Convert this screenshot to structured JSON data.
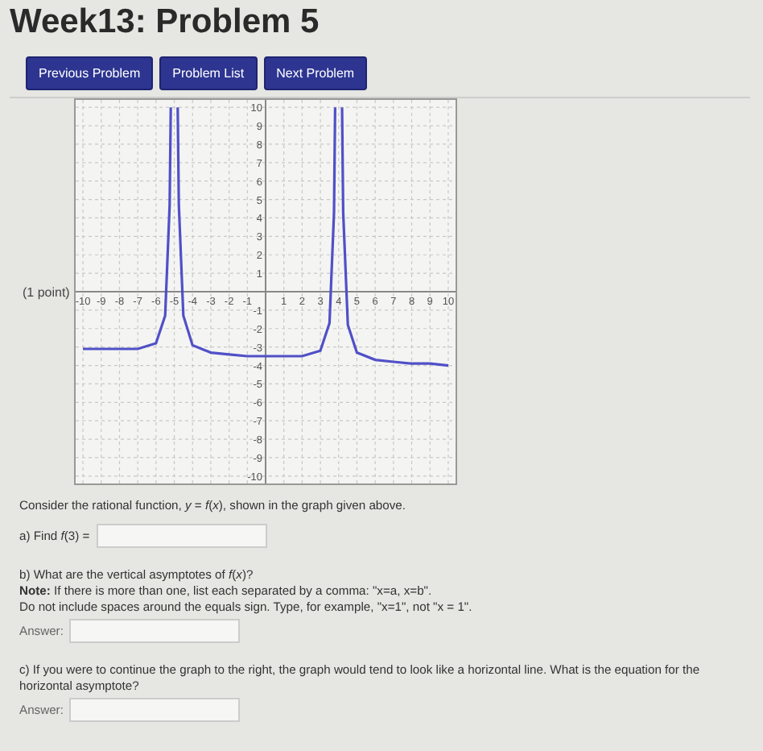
{
  "title": "Week13: Problem 5",
  "nav_buttons": [
    "Previous Problem",
    "Problem List",
    "Next Problem"
  ],
  "points": "(1 point)",
  "graph": {
    "chart_data": {
      "type": "line",
      "xlim": [
        -10,
        10
      ],
      "ylim": [
        -10,
        10
      ],
      "xticks": [
        -10,
        -9,
        -8,
        -7,
        -6,
        -5,
        -4,
        -3,
        -2,
        -1,
        1,
        2,
        3,
        4,
        5,
        6,
        7,
        8,
        9,
        10
      ],
      "yticks": [
        -10,
        -9,
        -8,
        -7,
        -6,
        -5,
        -4,
        -3,
        -2,
        -1,
        1,
        2,
        3,
        4,
        5,
        6,
        7,
        8,
        9,
        10
      ],
      "grid": true,
      "x": [
        -10,
        -9,
        -8,
        -7,
        -6,
        -5.5,
        -5.25,
        -5.19,
        -5,
        -4.81,
        -4.75,
        -4.5,
        -4,
        -3,
        -2,
        -1,
        0,
        1,
        2,
        3,
        3.5,
        3.75,
        3.81,
        4,
        4.19,
        4.25,
        4.5,
        5,
        6,
        7,
        8,
        9,
        10
      ],
      "series": [
        {
          "color": "#5050c8",
          "values": [
            -3.1,
            -3.1,
            -3.1,
            -3.1,
            -2.8,
            -1.3,
            4.7,
            10,
            null,
            10,
            4.7,
            -1.3,
            -2.9,
            -3.3,
            -3.4,
            -3.5,
            -3.5,
            -3.5,
            -3.5,
            -3.2,
            -1.7,
            4.3,
            10,
            null,
            10,
            4.3,
            -1.8,
            -3.3,
            -3.7,
            -3.8,
            -3.9,
            -3.9,
            -4
          ]
        }
      ]
    }
  },
  "intro": "Consider the rational function, *y* = *f*(*x*), shown in the graph given above.",
  "parts": [
    {
      "kind": "inline",
      "lines": [
        "a) Find *f*(3) ="
      ]
    },
    {
      "kind": "answer",
      "lines": [
        "b) What are the vertical asymptotes of *f*(*x*)?",
        "**Note:** If there is more than one, list each separated by a comma: \"x=a, x=b\".",
        "Do not include spaces around the equals sign. Type, for example, \"x=1\", not \"x = 1\"."
      ],
      "answer_label": "Answer:"
    },
    {
      "kind": "answer",
      "lines": [
        "c) If you were to continue the graph to the right, the graph would tend to look like a horizontal line. What is the equation for the horizontal asymptote?"
      ],
      "answer_label": "Answer:"
    }
  ]
}
